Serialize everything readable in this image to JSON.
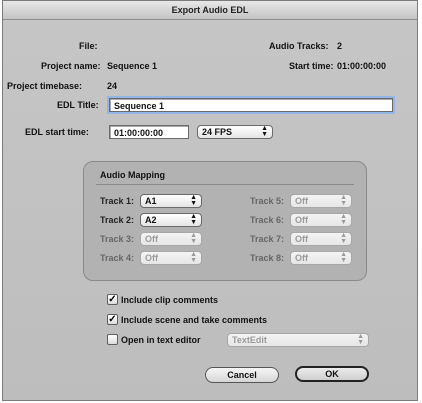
{
  "window": {
    "title": "Export Audio EDL"
  },
  "info": {
    "file_label": "File:",
    "audio_tracks_label": "Audio Tracks:",
    "audio_tracks_value": "2",
    "project_name_label": "Project name:",
    "project_name_value": "Sequence 1",
    "start_time_label": "Start time:",
    "start_time_value": "01:00:00:00",
    "project_timebase_label": "Project timebase:",
    "project_timebase_value": "24"
  },
  "edl": {
    "title_label": "EDL Title:",
    "title_value": "Sequence 1",
    "start_time_label": "EDL start time:",
    "start_time_value": "01:00:00:00",
    "fps_value": "24 FPS"
  },
  "audio_mapping": {
    "title": "Audio Mapping",
    "tracks": [
      {
        "label": "Track 1:",
        "value": "A1",
        "enabled": true
      },
      {
        "label": "Track 2:",
        "value": "A2",
        "enabled": true
      },
      {
        "label": "Track 3:",
        "value": "Off",
        "enabled": false
      },
      {
        "label": "Track 4:",
        "value": "Off",
        "enabled": false
      },
      {
        "label": "Track 5:",
        "value": "Off",
        "enabled": false
      },
      {
        "label": "Track 6:",
        "value": "Off",
        "enabled": false
      },
      {
        "label": "Track 7:",
        "value": "Off",
        "enabled": false
      },
      {
        "label": "Track 8:",
        "value": "Off",
        "enabled": false
      }
    ]
  },
  "options": {
    "include_clip_comments": {
      "label": "Include clip comments",
      "checked": true
    },
    "include_scene_take": {
      "label": "Include scene and take comments",
      "checked": true
    },
    "open_in_text_editor": {
      "label": "Open in text editor",
      "checked": false
    },
    "text_editor_value": "TextEdit"
  },
  "buttons": {
    "cancel": "Cancel",
    "ok": "OK"
  },
  "icons": {
    "checkmark": "checkmark-icon",
    "popup_arrows": "popup-arrows-icon"
  }
}
